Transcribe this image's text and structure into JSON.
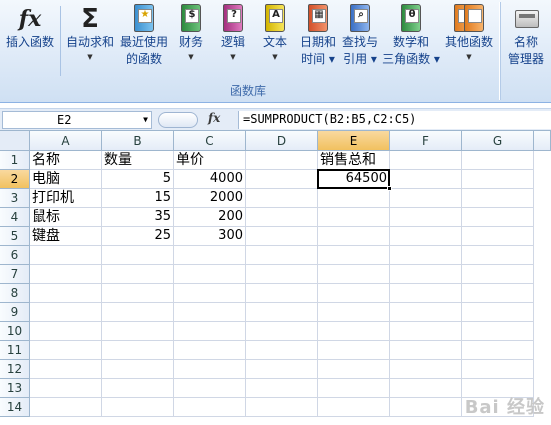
{
  "ribbon": {
    "buttons": [
      {
        "label": "插入函数",
        "label2": "",
        "icon": "fx-icon",
        "glyph": "fx"
      },
      {
        "label": "自动求和",
        "label2": "",
        "icon": "sigma-icon",
        "glyph": "Σ"
      },
      {
        "label": "最近使用",
        "label2": "的函数",
        "icon": "recent-functions-icon",
        "glyph": "★"
      },
      {
        "label": "财务",
        "label2": "",
        "icon": "financial-icon",
        "glyph": "$"
      },
      {
        "label": "逻辑",
        "label2": "",
        "icon": "logical-icon",
        "glyph": "?"
      },
      {
        "label": "文本",
        "label2": "",
        "icon": "text-icon",
        "glyph": "A"
      },
      {
        "label": "日期和",
        "label2": "时间",
        "icon": "datetime-icon",
        "glyph": "▦"
      },
      {
        "label": "查找与",
        "label2": "引用",
        "icon": "lookup-icon",
        "glyph": "⌕"
      },
      {
        "label": "数学和",
        "label2": "三角函数",
        "icon": "math-icon",
        "glyph": "θ"
      },
      {
        "label": "其他函数",
        "label2": "",
        "icon": "more-functions-icon",
        "glyph": ""
      },
      {
        "label": "名称",
        "label2": "管理器",
        "icon": "name-manager-icon",
        "glyph": ""
      }
    ],
    "group_label": "函数库"
  },
  "formula_bar": {
    "name_box": "E2",
    "fx_label": "fx",
    "formula": "=SUMPRODUCT(B2:B5,C2:C5)"
  },
  "grid": {
    "columns": [
      "A",
      "B",
      "C",
      "D",
      "E",
      "F",
      "G"
    ],
    "rows": [
      "1",
      "2",
      "3",
      "4",
      "5",
      "6",
      "7",
      "8",
      "9",
      "10",
      "11",
      "12",
      "13",
      "14"
    ],
    "active_cell": "E2",
    "cells": {
      "A1": "名称",
      "B1": "数量",
      "C1": "单价",
      "E1": "销售总和",
      "A2": "电脑",
      "B2": "5",
      "C2": "4000",
      "E2": "64500",
      "A3": "打印机",
      "B3": "15",
      "C3": "2000",
      "A4": "鼠标",
      "B4": "35",
      "C4": "200",
      "A5": "键盘",
      "B5": "25",
      "C5": "300"
    }
  },
  "watermark": "Bai 经验",
  "colors": {
    "ribbon_text": "#15428b",
    "header_active": "#f1c15f",
    "gridline": "#d0d7e5"
  }
}
